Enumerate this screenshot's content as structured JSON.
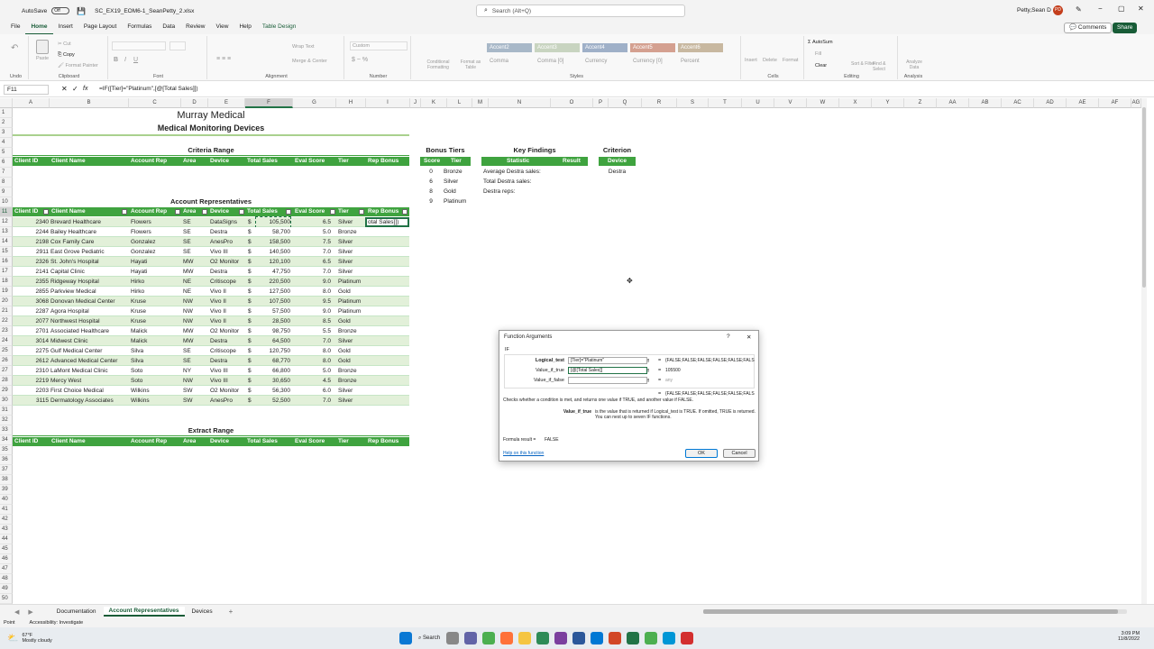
{
  "title": {
    "autosave": "AutoSave",
    "autosave_state": "Off",
    "filename": "SC_EX19_EOM6-1_SeanPetty_2.xlsx",
    "search_placeholder": "Search (Alt+Q)",
    "user": "Petty,Sean D",
    "user_initials": "PD"
  },
  "menu": {
    "items": [
      "File",
      "Home",
      "Insert",
      "Page Layout",
      "Formulas",
      "Data",
      "Review",
      "View",
      "Help",
      "Table Design"
    ],
    "comments": "Comments",
    "share": "Share"
  },
  "ribbon": {
    "undo": "Undo",
    "clipboard": "Clipboard",
    "paste": "Paste",
    "cut": "Cut",
    "copy": "Copy",
    "format_painter": "Format Painter",
    "font": "Font",
    "alignment": "Alignment",
    "wrap_text": "Wrap Text",
    "merge_center": "Merge & Center",
    "number": "Number",
    "number_format": "Custom",
    "styles": "Styles",
    "conditional_formatting": "Conditional Formatting",
    "format_as_table": "Format as Table",
    "style_items": [
      "Accent2",
      "Accent3",
      "Accent4",
      "Accent5",
      "Accent6",
      "Comma",
      "Comma [0]",
      "Currency",
      "Currency [0]",
      "Percent"
    ],
    "cells": "Cells",
    "insert": "Insert",
    "delete": "Delete",
    "format": "Format",
    "editing": "Editing",
    "autosum": "AutoSum",
    "fill": "Fill",
    "clear": "Clear",
    "sort_filter": "Sort & Filter",
    "find_select": "Find & Select",
    "analysis": "Analysis",
    "analyze_data": "Analyze Data"
  },
  "formula": {
    "namebox": "F11",
    "fx": "fx",
    "content": "=IF([Tier]=\"Platinum\",[@[Total Sales]])"
  },
  "columns": [
    "A",
    "B",
    "C",
    "D",
    "E",
    "F",
    "G",
    "H",
    "I",
    "J",
    "K",
    "L",
    "M",
    "N",
    "O",
    "P",
    "Q",
    "R",
    "S",
    "T",
    "U",
    "V",
    "W",
    "X",
    "Y",
    "Z",
    "AA",
    "AB",
    "AC",
    "AD",
    "AE",
    "AF",
    "AG"
  ],
  "sheet": {
    "title": "Murray Medical",
    "subtitle": "Medical Monitoring Devices",
    "criteria_range": "Criteria Range",
    "account_reps": "Account Representatives",
    "extract_range": "Extract Range",
    "headers": [
      "Client ID",
      "Client Name",
      "Account Rep",
      "Area",
      "Device",
      "Total Sales",
      "Eval Score",
      "Tier",
      "Rep Bonus"
    ],
    "currency_symbol": "$",
    "active_cell_text": "otal Sales]])",
    "rows": [
      [
        "2340",
        "Brevard Healthcare",
        "Flowers",
        "SE",
        "DataSigns",
        "105,500",
        "6.5",
        "Silver"
      ],
      [
        "2244",
        "Bailey Healthcare",
        "Flowers",
        "SE",
        "Destra",
        "58,700",
        "5.0",
        "Bronze"
      ],
      [
        "2198",
        "Cox Family Care",
        "Gonzalez",
        "SE",
        "AnesPro",
        "158,500",
        "7.5",
        "Silver"
      ],
      [
        "2911",
        "East Grove Pediatric",
        "Gonzalez",
        "SE",
        "Vivo III",
        "140,500",
        "7.0",
        "Silver"
      ],
      [
        "2326",
        "St. John's Hospital",
        "Hayati",
        "MW",
        "O2 Monitor",
        "120,100",
        "6.5",
        "Silver"
      ],
      [
        "2141",
        "Capital Clinic",
        "Hayati",
        "MW",
        "Destra",
        "47,750",
        "7.0",
        "Silver"
      ],
      [
        "2355",
        "Ridgeway Hospital",
        "Hirko",
        "NE",
        "Critiscope",
        "220,500",
        "9.0",
        "Platinum"
      ],
      [
        "2855",
        "Parkview Medical",
        "Hirko",
        "NE",
        "Vivo II",
        "127,500",
        "8.0",
        "Gold"
      ],
      [
        "3068",
        "Donovan Medical Center",
        "Kruse",
        "NW",
        "Vivo II",
        "107,500",
        "9.5",
        "Platinum"
      ],
      [
        "2287",
        "Agora Hospital",
        "Kruse",
        "NW",
        "Vivo II",
        "57,500",
        "9.0",
        "Platinum"
      ],
      [
        "2077",
        "Northwest Hospital",
        "Kruse",
        "NW",
        "Vivo II",
        "28,500",
        "8.5",
        "Gold"
      ],
      [
        "2701",
        "Associated Healthcare",
        "Malick",
        "MW",
        "O2 Monitor",
        "98,750",
        "5.5",
        "Bronze"
      ],
      [
        "3014",
        "Midwest Clinic",
        "Malick",
        "MW",
        "Destra",
        "64,500",
        "7.0",
        "Silver"
      ],
      [
        "2275",
        "Gulf Medical Center",
        "Silva",
        "SE",
        "Critiscope",
        "120,750",
        "8.0",
        "Gold"
      ],
      [
        "2612",
        "Advanced Medical Center",
        "Silva",
        "SE",
        "Destra",
        "68,770",
        "8.0",
        "Gold"
      ],
      [
        "2310",
        "LaMont Medical Clinic",
        "Soto",
        "NY",
        "Vivo III",
        "66,800",
        "5.0",
        "Bronze"
      ],
      [
        "2219",
        "Mercy West",
        "Soto",
        "NW",
        "Vivo III",
        "30,650",
        "4.5",
        "Bronze"
      ],
      [
        "2203",
        "First Choice Medical",
        "Wilkins",
        "SW",
        "O2 Monitor",
        "56,300",
        "6.0",
        "Silver"
      ],
      [
        "3115",
        "Dermatology Associates",
        "Wilkins",
        "SW",
        "AnesPro",
        "52,500",
        "7.0",
        "Silver"
      ]
    ],
    "bonus": {
      "title": "Bonus Tiers",
      "headers": [
        "Score",
        "Tier"
      ],
      "rows": [
        [
          "0",
          "Bronze"
        ],
        [
          "6",
          "Silver"
        ],
        [
          "8",
          "Gold"
        ],
        [
          "9",
          "Platinum"
        ]
      ]
    },
    "findings": {
      "title": "Key Findings",
      "headers": [
        "Statistic",
        "Result"
      ],
      "rows": [
        "Average Destra sales:",
        "Total Destra sales:",
        "Destra reps:"
      ]
    },
    "criterion": {
      "title": "Criterion",
      "header": "Device",
      "value": "Destra"
    }
  },
  "dialog": {
    "title": "Function Arguments",
    "help_q": "?",
    "close": "✕",
    "func": "IF",
    "args": [
      {
        "label": "Logical_test",
        "value": "[Tier]=\"Platinum\"",
        "result": "{FALSE;FALSE;FALSE;FALSE;FALSE;FALS"
      },
      {
        "label": "Value_if_true",
        "value": "[@[Total Sales]]",
        "result": "105500"
      },
      {
        "label": "Value_if_false",
        "value": "",
        "result": "any"
      }
    ],
    "eq": "=",
    "overall": "{FALSE;FALSE;FALSE;FALSE;FALSE;FALS",
    "description": "Checks whether a condition is met, and returns one value if TRUE, and another value if FALSE.",
    "param_name": "Value_if_true",
    "param_desc": "is the value that is returned if Logical_test is TRUE. If omitted, TRUE is returned. You can nest up to seven IF functions.",
    "formula_result_label": "Formula result =",
    "formula_result": "FALSE",
    "help_link": "Help on this function",
    "ok": "OK",
    "cancel": "Cancel"
  },
  "tabs": {
    "items": [
      "Documentation",
      "Account Representatives",
      "Devices"
    ],
    "active": 1,
    "add": "+"
  },
  "status": {
    "ready": "Point",
    "accessibility": "Accessibility: Investigate"
  },
  "taskbar": {
    "weather_temp": "67°F",
    "weather_desc": "Mostly cloudy",
    "search": "Search",
    "time": "3:09 PM",
    "date": "11/8/2022"
  },
  "colors": {
    "green": "#3fa33f",
    "band": "#e2f0d9",
    "excel": "#185c37"
  }
}
